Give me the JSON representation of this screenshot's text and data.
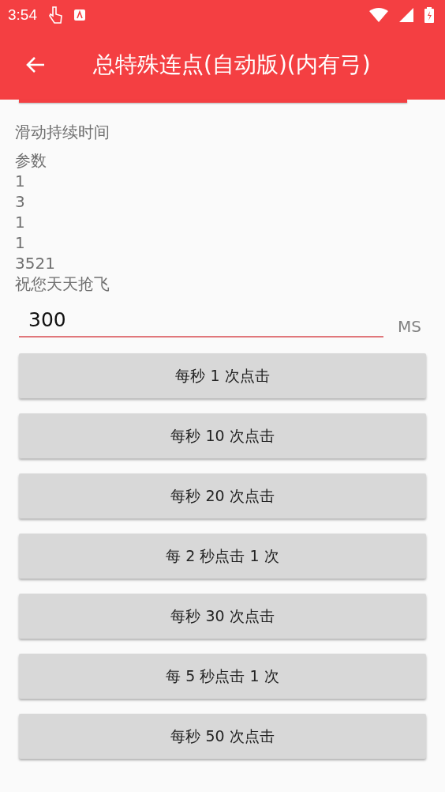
{
  "status_bar": {
    "time": "3:54"
  },
  "app_bar": {
    "title": "总特殊连点(自动版)(内有弓)"
  },
  "info_lines": [
    {
      "text": "滑动持续时间",
      "kind": "heading"
    },
    {
      "text": "参数",
      "kind": "line"
    },
    {
      "text": "1",
      "kind": "line"
    },
    {
      "text": "3",
      "kind": "line"
    },
    {
      "text": "1",
      "kind": "line"
    },
    {
      "text": "1",
      "kind": "line"
    },
    {
      "text": "3521",
      "kind": "line"
    },
    {
      "text": "祝您天天抢飞",
      "kind": "line"
    }
  ],
  "duration_field": {
    "value": "300",
    "unit": "MS"
  },
  "buttons": [
    "每秒 1 次点击",
    "每秒 10 次点击",
    "每秒 20 次点击",
    "每 2 秒点击 1 次",
    "每秒 30 次点击",
    "每 5 秒点击 1 次",
    "每秒 50 次点击"
  ]
}
